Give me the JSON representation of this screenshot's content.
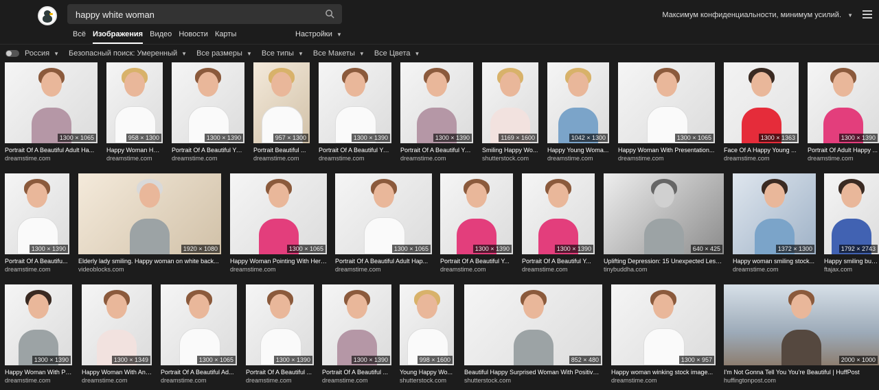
{
  "search": {
    "query": "happy white woman"
  },
  "header": {
    "privacy": "Максимум конфиденциальности, минимум усилий.",
    "tabs": [
      "Всё",
      "Изображения",
      "Видео",
      "Новости",
      "Карты"
    ],
    "settings": "Настройки"
  },
  "filters": [
    "Россия",
    "Безопасный поиск: Умеренный",
    "Все размеры",
    "Все типы",
    "Все Макеты",
    "Все Цвета"
  ],
  "results": [
    {
      "title": "Portrait Of A Beautiful Adult Ha...",
      "source": "dreamstime.com",
      "size": "1300 × 1065"
    },
    {
      "title": "Happy Woman Hol...",
      "source": "dreamstime.com",
      "size": "958 × 1300"
    },
    {
      "title": "Portrait Of A Beautiful Yo...",
      "source": "dreamstime.com",
      "size": "1300 × 1390"
    },
    {
      "title": "Portrait Beautiful ...",
      "source": "dreamstime.com",
      "size": "957 × 1300"
    },
    {
      "title": "Portrait Of A Beautiful Yo...",
      "source": "dreamstime.com",
      "size": "1300 × 1390"
    },
    {
      "title": "Portrait Of A Beautiful Yo...",
      "source": "dreamstime.com",
      "size": "1300 × 1390"
    },
    {
      "title": "Smiling Happy Wo...",
      "source": "shutterstock.com",
      "size": "1169 × 1600"
    },
    {
      "title": "Happy Young Woma...",
      "source": "dreamstime.com",
      "size": "1042 × 1300"
    },
    {
      "title": "Happy Woman With Presentation...",
      "source": "dreamstime.com",
      "size": "1300 × 1065"
    },
    {
      "title": "Face Of A Happy Young ...",
      "source": "dreamstime.com",
      "size": "1300 × 1363"
    },
    {
      "title": "Portrait Of Adult Happy ...",
      "source": "dreamstime.com",
      "size": "1300 × 1390"
    },
    {
      "title": "Portrait Of A Beautifu...",
      "source": "dreamstime.com",
      "size": "1300 × 1390"
    },
    {
      "title": "Elderly lady smiling. Happy woman on white back...",
      "source": "videoblocks.com",
      "size": "1920 × 1080"
    },
    {
      "title": "Happy Woman Pointing With Her ...",
      "source": "dreamstime.com",
      "size": "1300 × 1065"
    },
    {
      "title": "Portrait Of A Beautiful Adult Hap...",
      "source": "dreamstime.com",
      "size": "1300 × 1065"
    },
    {
      "title": "Portrait Of A Beautiful Y...",
      "source": "dreamstime.com",
      "size": "1300 × 1390"
    },
    {
      "title": "Portrait Of A Beautiful Y...",
      "source": "dreamstime.com",
      "size": "1300 × 1390"
    },
    {
      "title": "Uplifting Depression: 15 Unexpected Less...",
      "source": "tinybuddha.com",
      "size": "640 × 425"
    },
    {
      "title": "Happy woman smiling stock...",
      "source": "dreamstime.com",
      "size": "1372 × 1300"
    },
    {
      "title": "Happy smiling bus...",
      "source": "ftajax.com",
      "size": "1792 × 2743"
    },
    {
      "title": "Happy Woman With Pe...",
      "source": "dreamstime.com",
      "size": "1300 × 1390"
    },
    {
      "title": "Happy Woman With An ...",
      "source": "dreamstime.com",
      "size": "1300 × 1349"
    },
    {
      "title": "Portrait Of A Beautiful Ad...",
      "source": "dreamstime.com",
      "size": "1300 × 1065"
    },
    {
      "title": "Portrait Of A Beautiful ...",
      "source": "dreamstime.com",
      "size": "1300 × 1390"
    },
    {
      "title": "Portrait Of A Beautiful ...",
      "source": "dreamstime.com",
      "size": "1300 × 1390"
    },
    {
      "title": "Young Happy Wo...",
      "source": "shutterstock.com",
      "size": "998 × 1600"
    },
    {
      "title": "Beautiful Happy Surprised Woman With Positive ...",
      "source": "shutterstock.com",
      "size": "852 × 480"
    },
    {
      "title": "Happy woman winking stock image...",
      "source": "dreamstime.com",
      "size": "1300 × 957"
    },
    {
      "title": "I'm Not Gonna Tell You You're Beautiful | HuffPost",
      "source": "huffingtonpost.com",
      "size": "2000 × 1000"
    }
  ]
}
